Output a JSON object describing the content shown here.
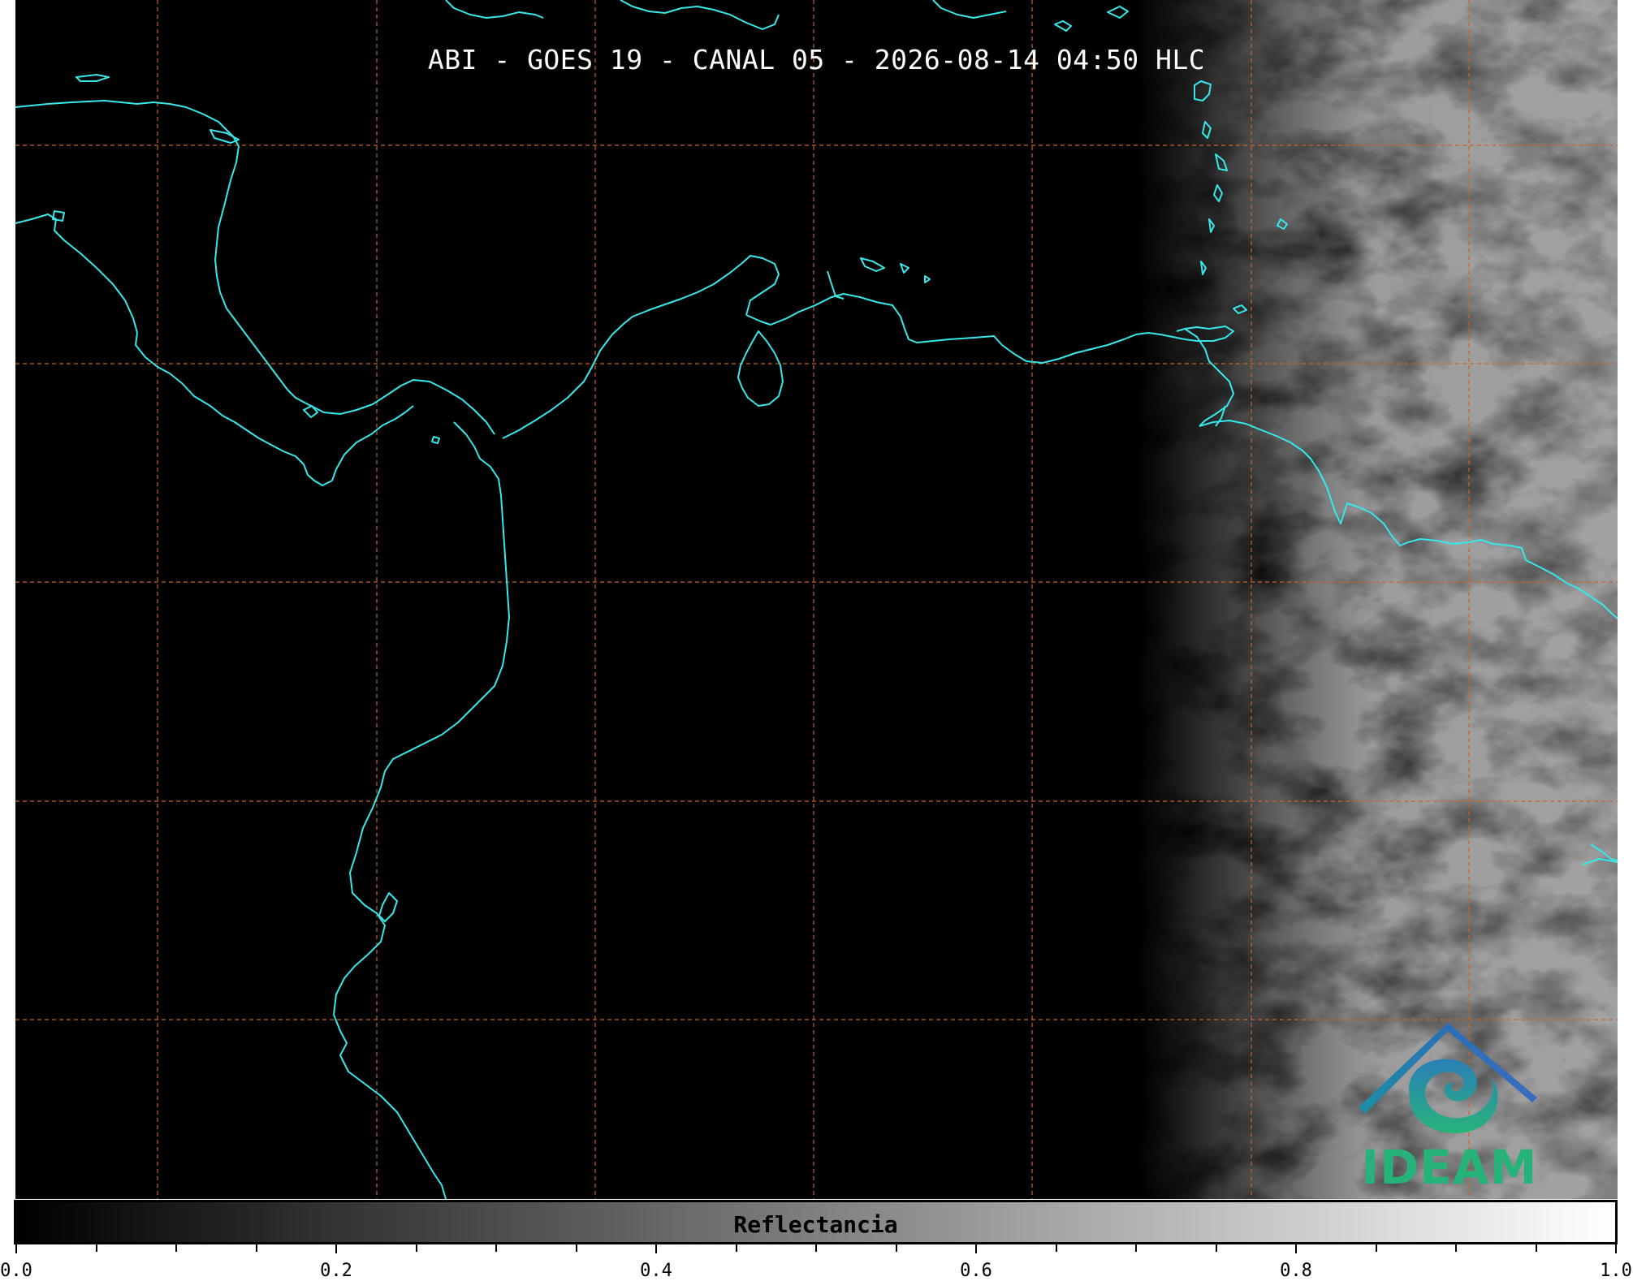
{
  "title": "ABI - GOES 19 - CANAL 05 - 2026-08-14 04:50 HLC",
  "logo": {
    "text": "IDEAM",
    "icon": "ideam-logo-icon"
  },
  "colorbar": {
    "label": "Reflectancia",
    "min": 0.0,
    "max": 1.0,
    "colormap": "grayscale black-to-white",
    "tick_labels": [
      "0.0",
      "0.2",
      "0.4",
      "0.6",
      "0.8",
      "1.0"
    ]
  },
  "map": {
    "background": "#000000",
    "coastline_color": "#37e8ea",
    "gridline_color": "#c8642a",
    "gridline_style": "dashed",
    "cloud_region": "east edge, grayscale reflectance"
  }
}
